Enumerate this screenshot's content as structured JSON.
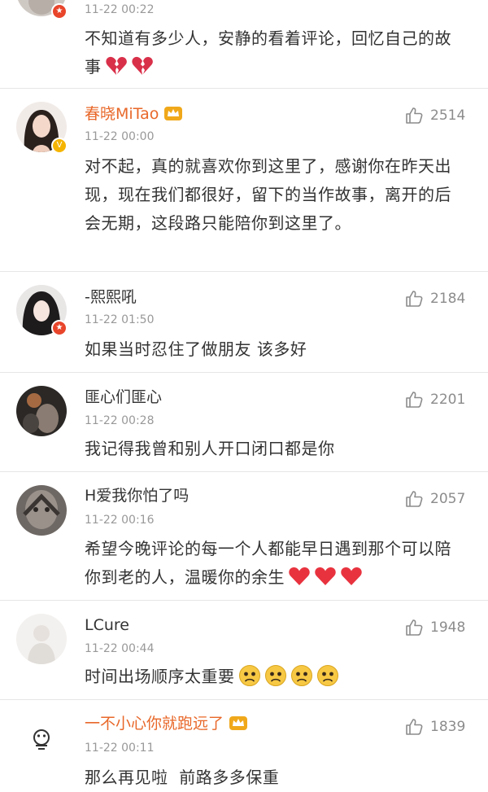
{
  "comments": [
    {
      "id": "c0",
      "username": "",
      "timestamp": "11-22 00:22",
      "text": "不知道有多少人，安静的看着评论，回忆自己的故事",
      "emoji": "broken-heart",
      "emoji_count": 2
    },
    {
      "id": "c1",
      "username": "春晓MiTao",
      "vip": true,
      "timestamp": "11-22 00:00",
      "likes": "2514",
      "text": "对不起，真的就喜欢你到这里了，感谢你在昨天出现，现在我们都很好，留下的当作故事，离开的后会无期，这段路只能陪你到这里了。"
    },
    {
      "id": "c2",
      "username": "-熙熙吼",
      "timestamp": "11-22 01:50",
      "likes": "2184",
      "text": "如果当时忍住了做朋友 该多好"
    },
    {
      "id": "c3",
      "username": "匪心们匪心",
      "timestamp": "11-22 00:28",
      "likes": "2201",
      "text": "我记得我曾和别人开口闭口都是你"
    },
    {
      "id": "c4",
      "username": "H爱我你怕了吗",
      "timestamp": "11-22 00:16",
      "likes": "2057",
      "text": "希望今晚评论的每一个人都能早日遇到那个可以陪你到老的人，温暖你的余生",
      "emoji": "red-heart",
      "emoji_count": 3
    },
    {
      "id": "c5",
      "username": "LCure",
      "timestamp": "11-22 00:44",
      "likes": "1948",
      "text": "时间出场顺序太重要",
      "emoji": "sad-face",
      "emoji_count": 4
    },
    {
      "id": "c6",
      "username": "一不小心你就跑远了",
      "vip": true,
      "timestamp": "11-22 00:11",
      "likes": "1839",
      "text": "那么再见啦  前路多多保重"
    }
  ],
  "icons": {
    "like": "thumbs-up-icon",
    "vip": "crown-icon",
    "verified": "verified-badge-icon"
  },
  "colors": {
    "vip_name": "#e8682a",
    "text": "#333333",
    "meta": "#999999",
    "badge_red": "#e8452b",
    "badge_gold": "#f5b400",
    "heart": "#e8333f",
    "broken_heart": "#d9304a",
    "sad_face": "#f7c843"
  }
}
